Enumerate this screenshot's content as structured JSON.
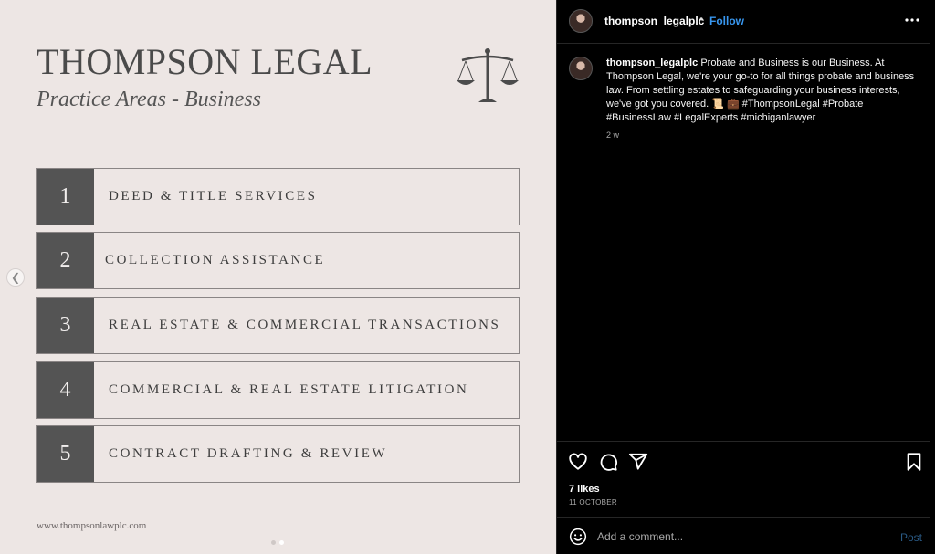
{
  "slide": {
    "title": "THOMPSON LEGAL",
    "subtitle": "Practice Areas - Business",
    "logo_icon": "scales-of-justice-icon",
    "practice_areas": [
      {
        "number": "1",
        "label": "DEED & TITLE SERVICES"
      },
      {
        "number": "2",
        "label": "COLLECTION ASSISTANCE"
      },
      {
        "number": "3",
        "label": "REAL ESTATE & COMMERCIAL TRANSACTIONS"
      },
      {
        "number": "4",
        "label": "COMMERCIAL & REAL ESTATE LITIGATION"
      },
      {
        "number": "5",
        "label": "CONTRACT DRAFTING & REVIEW"
      }
    ],
    "website": "www.thompsonlawplc.com",
    "carousel": {
      "count": 2,
      "active_index": 1
    },
    "colors": {
      "background": "#ede6e4",
      "number_box": "#545454",
      "text": "#4a4a4a"
    }
  },
  "header": {
    "username": "thompson_legalplc",
    "separator": "•",
    "follow_label": "Follow"
  },
  "caption": {
    "username": "thompson_legalplc",
    "text": "Probate and Business is our Business. At Thompson Legal, we're your go-to for all things probate and business law. From settling estates to safeguarding your business interests, we've got you covered. 📜 💼 #ThompsonLegal #Probate #BusinessLaw #LegalExperts #michiganlawyer",
    "time": "2 w"
  },
  "engagement": {
    "likes": "7 likes",
    "date": "11 OCTOBER"
  },
  "comment": {
    "placeholder": "Add a comment...",
    "post_label": "Post"
  },
  "icons": {
    "like": "heart-icon",
    "comment": "comment-icon",
    "share": "share-icon",
    "save": "bookmark-icon",
    "emoji": "emoji-icon",
    "more": "more-options-icon",
    "prev": "chevron-left-icon"
  },
  "colors": {
    "sidebar_bg": "#000000",
    "link": "#3897f0",
    "muted": "#a8a8a8"
  }
}
